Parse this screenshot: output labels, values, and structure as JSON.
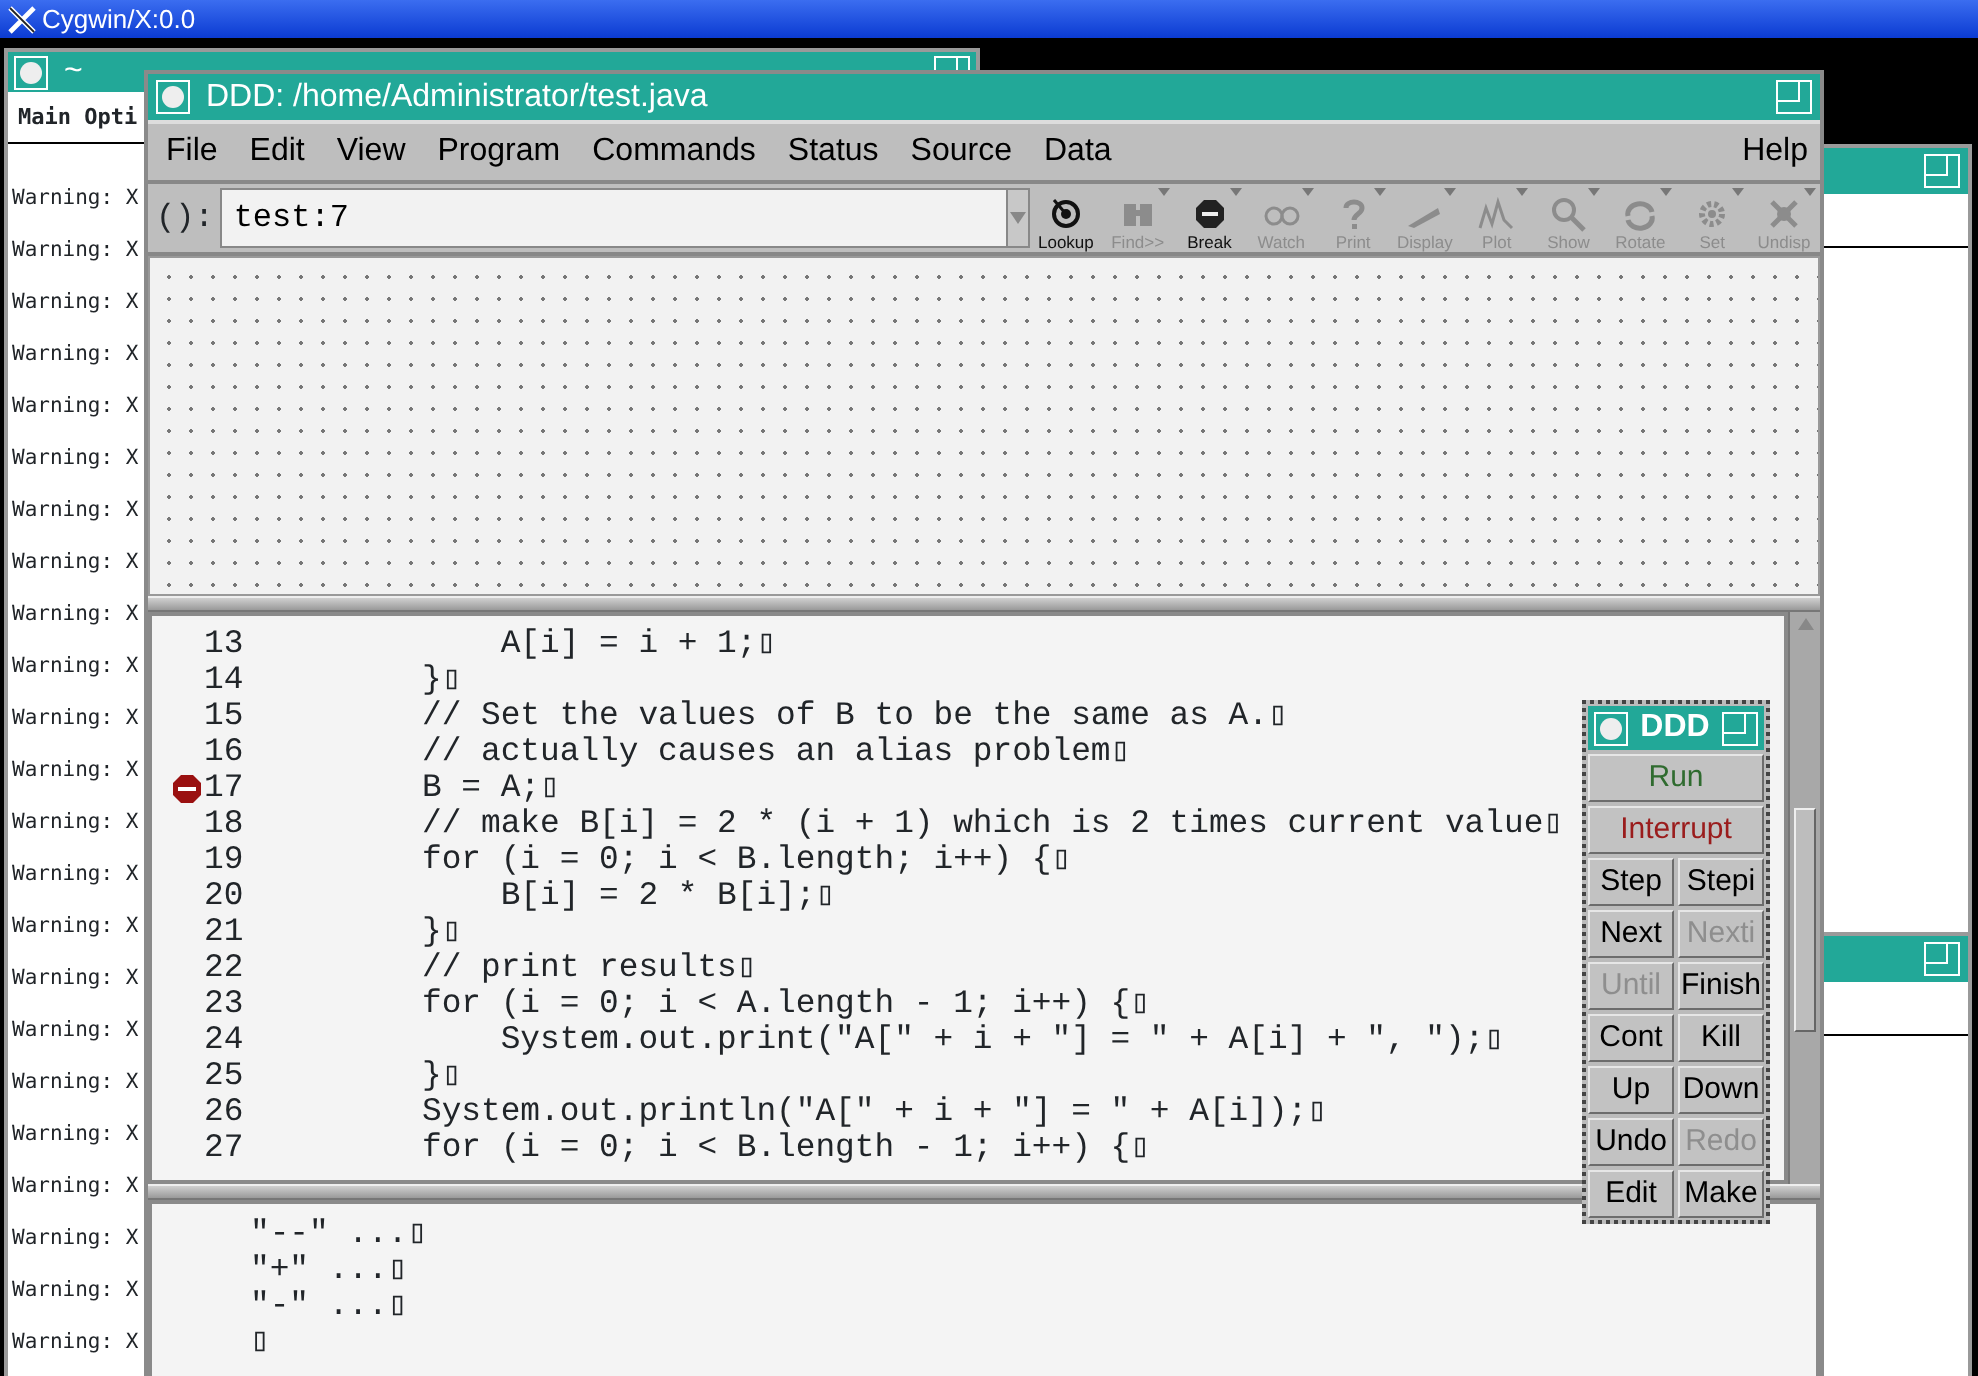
{
  "screen_title": "Cygwin/X:0.0",
  "xterm": {
    "title": "~",
    "menu": "Main Opti",
    "lines": [
      "Warning: X",
      "Warning: X",
      "Warning: X",
      "Warning: X",
      "Warning: X",
      "Warning: X",
      "Warning: X",
      "Warning: X",
      "Warning: X",
      "Warning: X",
      "Warning: X",
      "Warning: X",
      "Warning: X",
      "Warning: X",
      "Warning: X",
      "Warning: X",
      "Warning: X",
      "Warning: X",
      "Warning: X",
      "Warning: X",
      "Warning: X",
      "Warning: X",
      "Warning: X"
    ]
  },
  "ddd": {
    "title": "DDD: /home/Administrator/test.java",
    "menus": [
      {
        "label": "File"
      },
      {
        "label": "Edit"
      },
      {
        "label": "View"
      },
      {
        "label": "Program"
      },
      {
        "label": "Commands"
      },
      {
        "label": "Status"
      },
      {
        "label": "Source"
      },
      {
        "label": "Data"
      }
    ],
    "help_menu": "Help",
    "arg_label": "():",
    "arg_value": "test:7",
    "toolbar": [
      {
        "label": "Lookup",
        "disabled": false,
        "has_menu": false
      },
      {
        "label": "Find>>",
        "disabled": true,
        "has_menu": true
      },
      {
        "label": "Break",
        "disabled": false,
        "has_menu": true
      },
      {
        "label": "Watch",
        "disabled": true,
        "has_menu": true
      },
      {
        "label": "Print",
        "disabled": true,
        "has_menu": true
      },
      {
        "label": "Display",
        "disabled": true,
        "has_menu": true
      },
      {
        "label": "Plot",
        "disabled": true,
        "has_menu": true
      },
      {
        "label": "Show",
        "disabled": true,
        "has_menu": true
      },
      {
        "label": "Rotate",
        "disabled": true,
        "has_menu": true
      },
      {
        "label": "Set",
        "disabled": true,
        "has_menu": true
      },
      {
        "label": "Undisp",
        "disabled": true,
        "has_menu": true
      }
    ],
    "source": [
      {
        "number": "13",
        "code": "    A[i] = i + 1;▯",
        "breakpoint": false
      },
      {
        "number": "14",
        "code": "}▯",
        "breakpoint": false
      },
      {
        "number": "15",
        "code": "// Set the values of B to be the same as A.▯",
        "breakpoint": false
      },
      {
        "number": "16",
        "code": "// actually causes an alias problem▯",
        "breakpoint": false
      },
      {
        "number": "17",
        "code": "B = A;▯",
        "breakpoint": true
      },
      {
        "number": "18",
        "code": "// make B[i] = 2 * (i + 1) which is 2 times current value▯",
        "breakpoint": false
      },
      {
        "number": "19",
        "code": "for (i = 0; i < B.length; i++) {▯",
        "breakpoint": false
      },
      {
        "number": "20",
        "code": "    B[i] = 2 * B[i];▯",
        "breakpoint": false
      },
      {
        "number": "21",
        "code": "}▯",
        "breakpoint": false
      },
      {
        "number": "22",
        "code": "// print results▯",
        "breakpoint": false
      },
      {
        "number": "23",
        "code": "for (i = 0; i < A.length - 1; i++) {▯",
        "breakpoint": false
      },
      {
        "number": "24",
        "code": "    System.out.print(\"A[\" + i + \"] = \" + A[i] + \", \");▯",
        "breakpoint": false
      },
      {
        "number": "25",
        "code": "}▯",
        "breakpoint": false
      },
      {
        "number": "26",
        "code": "System.out.println(\"A[\" + i + \"] = \" + A[i]);▯",
        "breakpoint": false
      },
      {
        "number": "27",
        "code": "for (i = 0; i < B.length - 1; i++) {▯",
        "breakpoint": false
      }
    ],
    "console": [
      "\"--\" ...▯",
      "\"+\" ...▯",
      "\"-\" ...▯",
      "▯"
    ]
  },
  "command_tool": {
    "title": "DDD",
    "buttons": [
      {
        "label": "Run",
        "disabled": false,
        "wide": true,
        "color": "#2f6b2f"
      },
      {
        "label": "Interrupt",
        "disabled": false,
        "wide": true,
        "color": "#9a1c1c"
      },
      {
        "label": "Step",
        "disabled": false,
        "wide": false
      },
      {
        "label": "Stepi",
        "disabled": false,
        "wide": false
      },
      {
        "label": "Next",
        "disabled": false,
        "wide": false
      },
      {
        "label": "Nexti",
        "disabled": true,
        "wide": false
      },
      {
        "label": "Until",
        "disabled": true,
        "wide": false
      },
      {
        "label": "Finish",
        "disabled": false,
        "wide": false
      },
      {
        "label": "Cont",
        "disabled": false,
        "wide": false
      },
      {
        "label": "Kill",
        "disabled": false,
        "wide": false
      },
      {
        "label": "Up",
        "disabled": false,
        "wide": false
      },
      {
        "label": "Down",
        "disabled": false,
        "wide": false
      },
      {
        "label": "Undo",
        "disabled": false,
        "wide": false
      },
      {
        "label": "Redo",
        "disabled": true,
        "wide": false
      },
      {
        "label": "Edit",
        "disabled": false,
        "wide": false
      },
      {
        "label": "Make",
        "disabled": false,
        "wide": false
      }
    ]
  }
}
